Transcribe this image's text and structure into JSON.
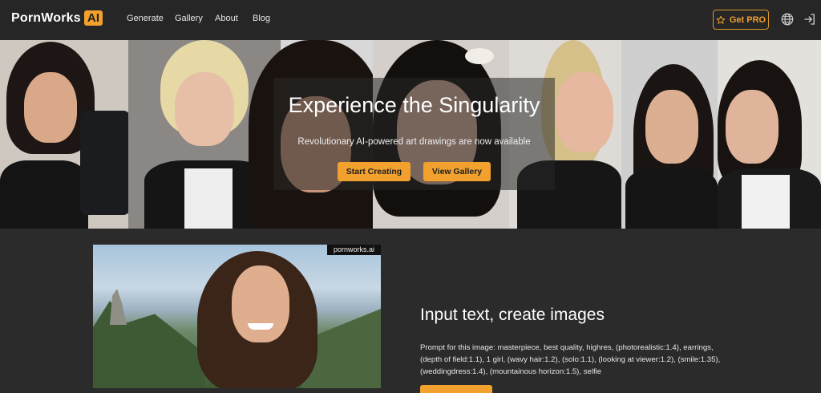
{
  "logo": {
    "text": "PornWorks",
    "badge": "AI"
  },
  "nav": {
    "links": [
      "Generate",
      "Gallery",
      "About",
      "Blog"
    ],
    "get_pro": "Get PRO",
    "icons": [
      "globe-icon",
      "login-icon"
    ]
  },
  "hero": {
    "title": "Experience the Singularity",
    "subtitle": "Revolutionary AI-powered art drawings are now available",
    "start_button": "Start Creating",
    "gallery_button": "View Gallery"
  },
  "feature": {
    "watermark": "pornworks.ai",
    "title": "Input text, create images",
    "prompt": "Prompt for this image: masterpiece, best quality, highres, (photorealistic:1.4), earrings, (depth of field:1.1), 1 girl, (wavy hair:1.2), (solo:1.1), (looking at viewer:1.2), (smile:1.35), (weddingdress:1.4), (mountainous horizon:1.5), selfie"
  },
  "colors": {
    "accent": "#f2a12e",
    "background": "#2b2b2b",
    "nav": "#262626"
  }
}
